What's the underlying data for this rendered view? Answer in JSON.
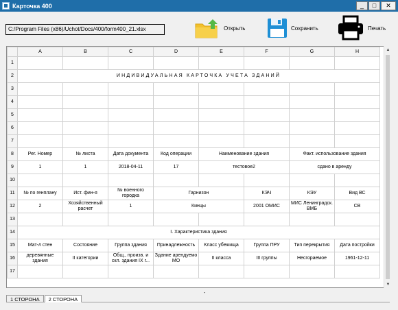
{
  "window": {
    "title": "Карточка 400"
  },
  "toolbar": {
    "path": "C:/Program Files (x86)/Uchot/Docs/400/form400_21.xlsx",
    "open_label": "Открыть",
    "save_label": "Сохранить",
    "print_label": "Печать"
  },
  "sheet": {
    "columns": [
      "A",
      "B",
      "C",
      "D",
      "E",
      "F",
      "G",
      "H"
    ],
    "rows": {
      "r2": "ИНДИВИДУАЛЬНАЯ КАРТОЧКА УЧЕТА ЗДАНИЙ",
      "r8": {
        "a": "Рег. Номер",
        "b": "№ листа",
        "c": "Дата документа",
        "d": "Код операции",
        "ef": "Наименование здания",
        "gh": "Факт. использование здания"
      },
      "r9": {
        "a": "1",
        "b": "1",
        "c": "2018-04-11",
        "d": "17",
        "ef": "тестовое2",
        "gh": "сдано в аренду"
      },
      "r11": {
        "a": "№ по генплану",
        "b": "Ист. фин-я",
        "c": "№ военного городка",
        "de": "Гарнизон",
        "f": "КЭЧ",
        "g": "КЭУ",
        "h": "Вид ВС"
      },
      "r12": {
        "a": "2",
        "b": "Хозяйственный расчет",
        "c": "1",
        "de": "Кинцы",
        "f": "2001 ОМИС",
        "g": "МИС Ленинградск. ВМБ",
        "h": "СВ"
      },
      "r14": "I. Характеристика здания",
      "r15": {
        "a": "Мат-л стен",
        "b": "Состояние",
        "c": "Группа здания",
        "d": "Принадлежность",
        "e": "Класс убежища",
        "f": "Группа ПРУ",
        "g": "Тип перекрытия",
        "h": "Дата постройки"
      },
      "r16": {
        "a": "деревянные здания",
        "b": "II категории",
        "c": "Общ., произв. и скл. здания IX г...",
        "d": "Здание арендуемо МО",
        "e": "II класса",
        "f": "III группы",
        "g": "Несгораемое",
        "h": "1961-12-11"
      }
    }
  },
  "tabs": [
    "1 СТОРОНА",
    "2 СТОРОНА"
  ],
  "hmarker": "-"
}
